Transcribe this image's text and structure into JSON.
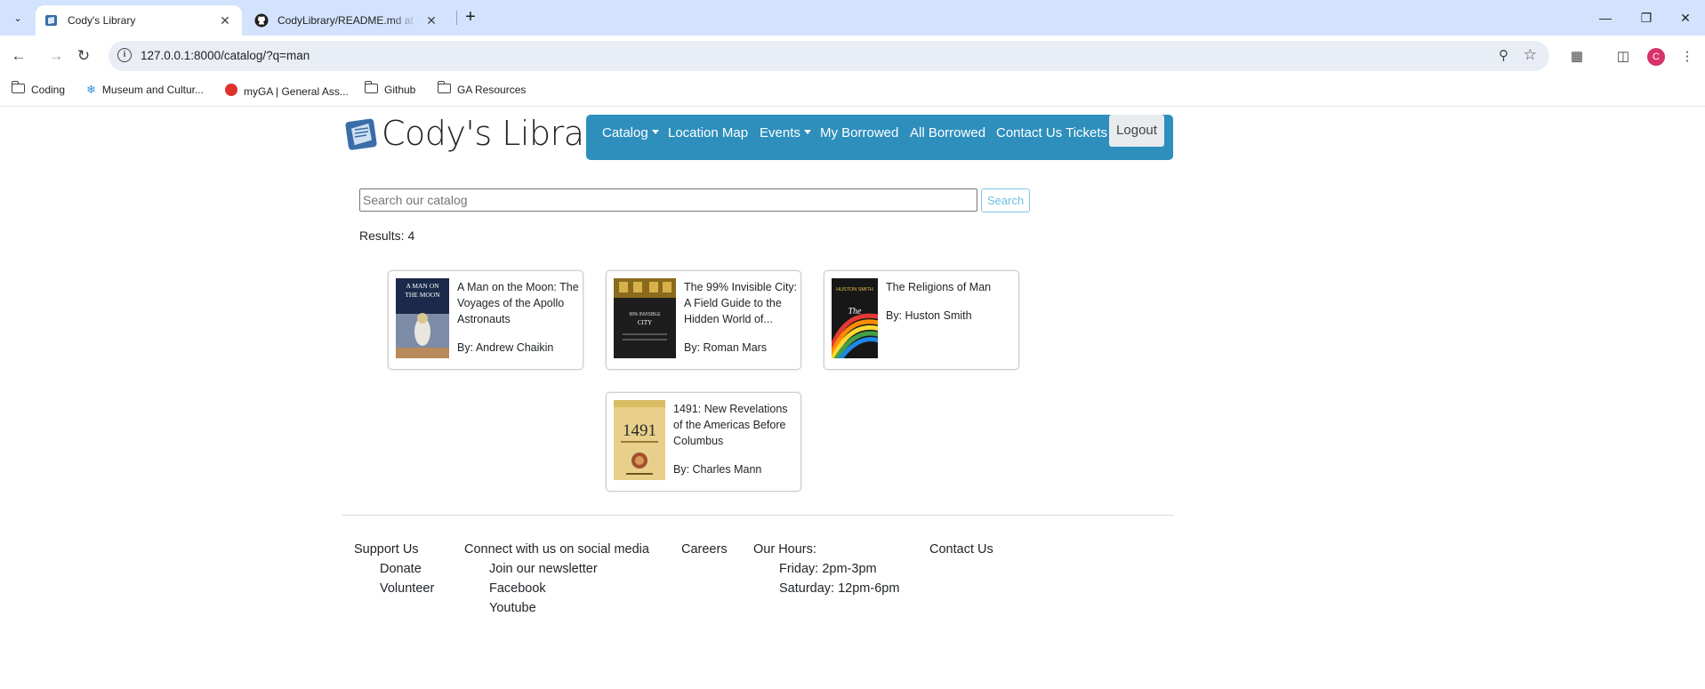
{
  "browser": {
    "tabs": [
      {
        "title": "Cody's Library",
        "active": true
      },
      {
        "title": "CodyLibrary/README.md at main",
        "active": false
      }
    ],
    "url": "127.0.0.1:8000/catalog/?q=man",
    "profile_initial": "C",
    "bookmarks": [
      {
        "label": "Coding",
        "icon": "folder-icon"
      },
      {
        "label": "Museum and Cultur...",
        "icon": "snowflake-icon"
      },
      {
        "label": "myGA | General Ass...",
        "icon": "ga-icon"
      },
      {
        "label": "Github",
        "icon": "folder-icon"
      },
      {
        "label": "GA Resources",
        "icon": "folder-icon"
      }
    ]
  },
  "site": {
    "title": "Cody's Library",
    "nav": {
      "catalog": "Catalog",
      "location_map": "Location Map",
      "events": "Events",
      "my_borrowed": "My Borrowed",
      "all_borrowed": "All Borrowed",
      "contact_tickets": "Contact Us Tickets",
      "logout": "Logout"
    },
    "accent_color": "#2e8fbd"
  },
  "search": {
    "placeholder": "Search our catalog",
    "button": "Search",
    "results_label": "Results: 4"
  },
  "books": [
    {
      "title": "A Man on the Moon: The Voyages of the Apollo Astronauts",
      "author": "By: Andrew Chaikin",
      "cover_text": "A MAN ON THE MOON"
    },
    {
      "title": "The 99% Invisible City: A Field Guide to the Hidden World of...",
      "author": "By: Roman Mars",
      "cover_text": "99% INVISIBLE CITY"
    },
    {
      "title": "The Religions of Man",
      "author": "By: Huston Smith",
      "cover_text": "The Religions of Man"
    },
    {
      "title": "1491: New Revelations of the Americas Before Columbus",
      "author": "By: Charles Mann",
      "cover_text": "1491"
    }
  ],
  "footer": {
    "support": {
      "heading": "Support Us",
      "items": [
        "Donate",
        "Volunteer"
      ]
    },
    "social": {
      "heading": "Connect with us on social media",
      "items": [
        "Join our newsletter",
        "Facebook",
        "Youtube"
      ]
    },
    "careers": "Careers",
    "hours": {
      "heading": "Our Hours:",
      "items": [
        "Friday: 2pm-3pm",
        "Saturday: 12pm-6pm"
      ]
    },
    "contact": "Contact Us"
  }
}
